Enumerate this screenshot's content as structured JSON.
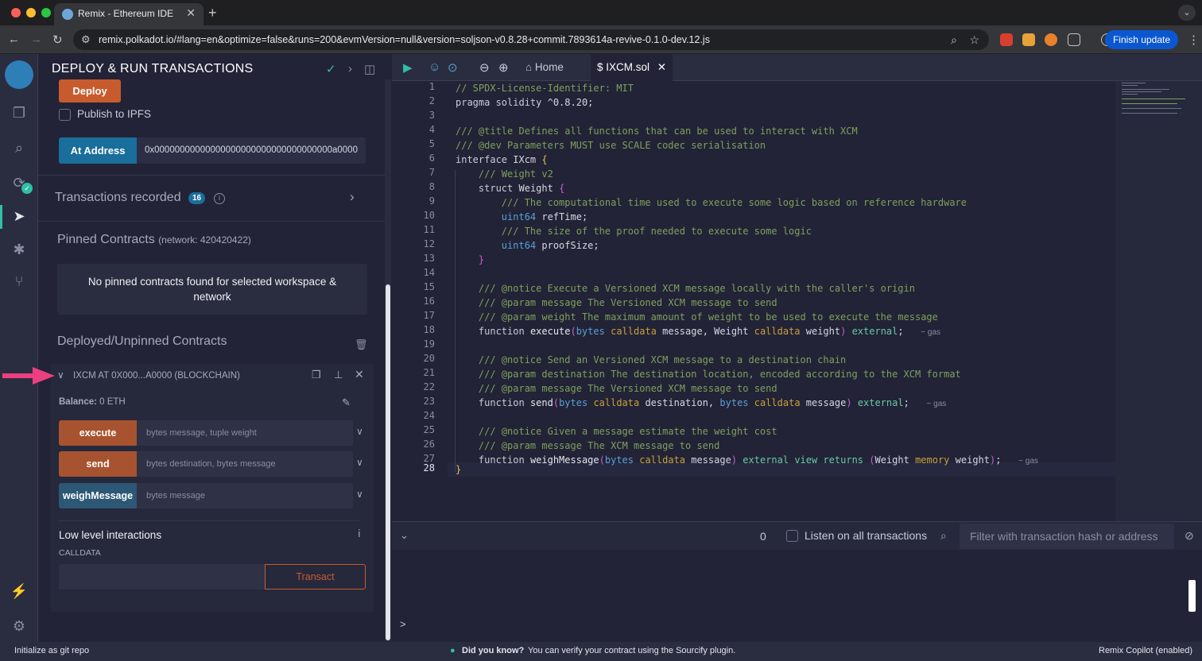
{
  "browser": {
    "tab_title": "Remix - Ethereum IDE",
    "tab_close": "✕",
    "new_tab": "+",
    "tab_menu": "⌄",
    "url": "remix.polkadot.io/#lang=en&optimize=false&runs=200&evmVersion=null&version=soljson-v0.8.28+commit.7893614a-revive-0.1.0-dev.12.js",
    "finish_update": "Finish update"
  },
  "panel": {
    "title": "DEPLOY & RUN TRANSACTIONS",
    "deploy_label": "Deploy",
    "publish_ipfs": "Publish to IPFS",
    "at_address_label": "At Address",
    "at_address_value": "0x00000000000000000000000000000000000a0000",
    "transactions_recorded": "Transactions recorded",
    "transactions_count": "16",
    "pinned_title": "Pinned Contracts",
    "pinned_network": "(network: 420420422)",
    "no_pinned_line1": "No pinned contracts found for selected workspace &",
    "no_pinned_line2": "network",
    "deployed_title": "Deployed/Unpinned Contracts",
    "instance_title": "IXCM AT 0X000...A0000 (BLOCKCHAIN)",
    "balance_label": "Balance:",
    "balance_value": "0 ETH",
    "functions": [
      {
        "name": "execute",
        "placeholder": "bytes message, tuple weight",
        "color": "#c75b2e"
      },
      {
        "name": "send",
        "placeholder": "bytes destination, bytes message",
        "color": "#c75b2e"
      },
      {
        "name": "weighMessage",
        "placeholder": "bytes message",
        "color": "#1a6e9c"
      }
    ],
    "low_level_title": "Low level interactions",
    "calldata_label": "CALLDATA",
    "transact_label": "Transact"
  },
  "editor": {
    "tab_home": "Home",
    "tab_file": "IXCM.sol",
    "line_numbers": [
      "1",
      "2",
      "3",
      "4",
      "5",
      "6",
      "7",
      "8",
      "9",
      "10",
      "11",
      "12",
      "13",
      "14",
      "15",
      "16",
      "17",
      "18",
      "19",
      "20",
      "21",
      "22",
      "23",
      "24",
      "25",
      "26",
      "27",
      "28"
    ],
    "gas_label": "~ gas"
  },
  "terminal": {
    "count": "0",
    "listen_label": "Listen on all transactions",
    "filter_placeholder": "Filter with transaction hash or address",
    "prompt": ">"
  },
  "statusbar": {
    "git": "Initialize as git repo",
    "did_you_know": "Did you know?",
    "tip": "You can verify your contract using the Sourcify plugin.",
    "copilot": "Remix Copilot (enabled)"
  },
  "colors": {
    "accent_orange": "#c75b2e",
    "accent_blue": "#1a6e9c",
    "pink_arrow": "#ec3f80"
  }
}
